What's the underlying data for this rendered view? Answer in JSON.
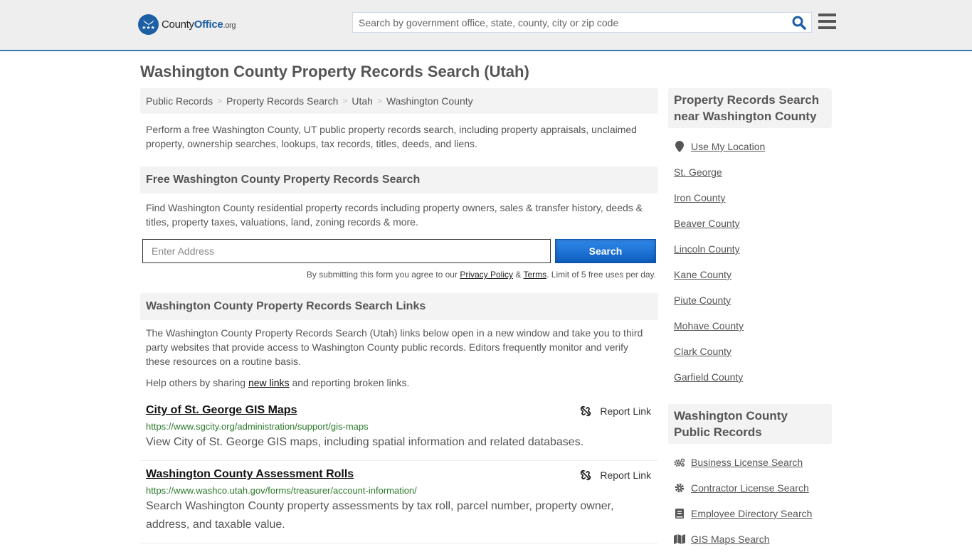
{
  "header": {
    "logo": {
      "brand_part1": "County",
      "brand_part2": "Office",
      "brand_suffix": ".org",
      "badge_glyph": "★★★"
    },
    "search": {
      "placeholder": "Search by government office, state, county, city or zip code",
      "value": ""
    },
    "colors": {
      "brand_blue": "#1c5fa5",
      "header_bg": "#eeeeee",
      "header_line": "#3a7ab0"
    }
  },
  "page": {
    "title": "Washington County Property Records Search (Utah)"
  },
  "breadcrumb": [
    {
      "label": "Public Records"
    },
    {
      "label": "Property Records Search"
    },
    {
      "label": "Utah"
    },
    {
      "label": "Washington County"
    }
  ],
  "intro": "Perform a free Washington County, UT public property records search, including property appraisals, unclaimed property, ownership searches, lookups, tax records, titles, deeds, and liens.",
  "free_search": {
    "heading": "Free Washington County Property Records Search",
    "description": "Find Washington County residential property records including property owners, sales & transfer history, deeds & titles, property taxes, valuations, land, zoning records & more.",
    "address_placeholder": "Enter Address",
    "address_value": "",
    "button_label": "Search",
    "disclaimer_prefix": "By submitting this form you agree to our ",
    "privacy_label": "Privacy Policy",
    "amp": " & ",
    "terms_label": "Terms",
    "disclaimer_suffix": ". Limit of 5 free uses per day.",
    "button_color": "#1a6fd0"
  },
  "links_section": {
    "heading": "Washington County Property Records Search Links",
    "description": "The Washington County Property Records Search (Utah) links below open in a new window and take you to third party websites that provide access to Washington County public records. Editors frequently monitor and verify these resources on a routine basis.",
    "help_prefix": "Help others by sharing ",
    "help_link": "new links",
    "help_suffix": " and reporting broken links.",
    "report_label": "Report Link",
    "items": [
      {
        "title": "City of St. George GIS Maps",
        "url": "https://www.sgcity.org/administration/support/gis-maps",
        "description": "View City of St. George GIS maps, including spatial information and related databases."
      },
      {
        "title": "Washington County Assessment Rolls",
        "url": "https://www.washco.utah.gov/forms/treasurer/account-information/",
        "description": "Search Washington County property assessments by tax roll, parcel number, property owner, address, and taxable value."
      }
    ]
  },
  "sidebar": {
    "nearby": {
      "heading": "Property Records Search near Washington County",
      "use_location": "Use My Location",
      "items": [
        "St. George",
        "Iron County",
        "Beaver County",
        "Lincoln County",
        "Kane County",
        "Piute County",
        "Mohave County",
        "Clark County",
        "Garfield County"
      ]
    },
    "public_records": {
      "heading": "Washington County Public Records",
      "items": [
        {
          "label": "Business License Search",
          "icon": "cogs-icon"
        },
        {
          "label": "Contractor License Search",
          "icon": "gear-icon"
        },
        {
          "label": "Employee Directory Search",
          "icon": "book-icon"
        },
        {
          "label": "GIS Maps Search",
          "icon": "map-icon"
        }
      ]
    }
  }
}
